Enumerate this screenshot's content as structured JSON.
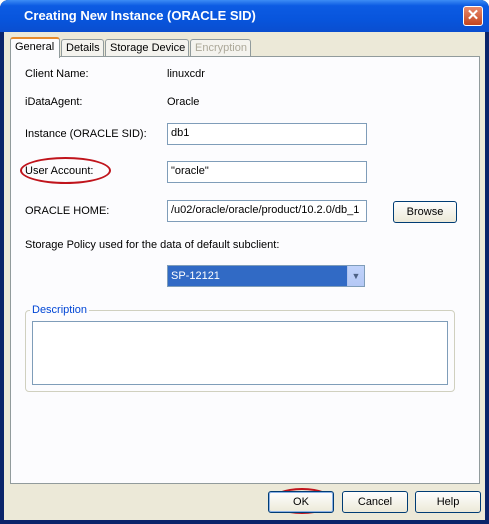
{
  "window": {
    "title": "Creating New Instance (ORACLE SID)",
    "close_symbol": "✕"
  },
  "tabs": [
    {
      "label": "General",
      "state": "active"
    },
    {
      "label": "Details",
      "state": "normal"
    },
    {
      "label": "Storage Device",
      "state": "normal"
    },
    {
      "label": "Encryption",
      "state": "disabled"
    }
  ],
  "general": {
    "client_name_label": "Client Name:",
    "client_name_value": "linuxcdr",
    "idataagent_label": "iDataAgent:",
    "idataagent_value": "Oracle",
    "instance_label": "Instance (ORACLE SID):",
    "instance_value": "db1",
    "user_account_label": "User Account:",
    "user_account_value": "\"oracle\"",
    "oracle_home_label": "ORACLE HOME:",
    "oracle_home_value": "/u02/oracle/oracle/product/10.2.0/db_1",
    "browse_label": "Browse",
    "storage_policy_label": "Storage Policy used for the data of default subclient:",
    "storage_policy_value": "SP-12121",
    "description_label": "Description"
  },
  "footer": {
    "ok_label": "OK",
    "cancel_label": "Cancel",
    "help_label": "Help"
  },
  "colors": {
    "highlight_circle": "#c0141c",
    "accent_tab": "#e68b2c",
    "title_bar": "#0855dd"
  }
}
